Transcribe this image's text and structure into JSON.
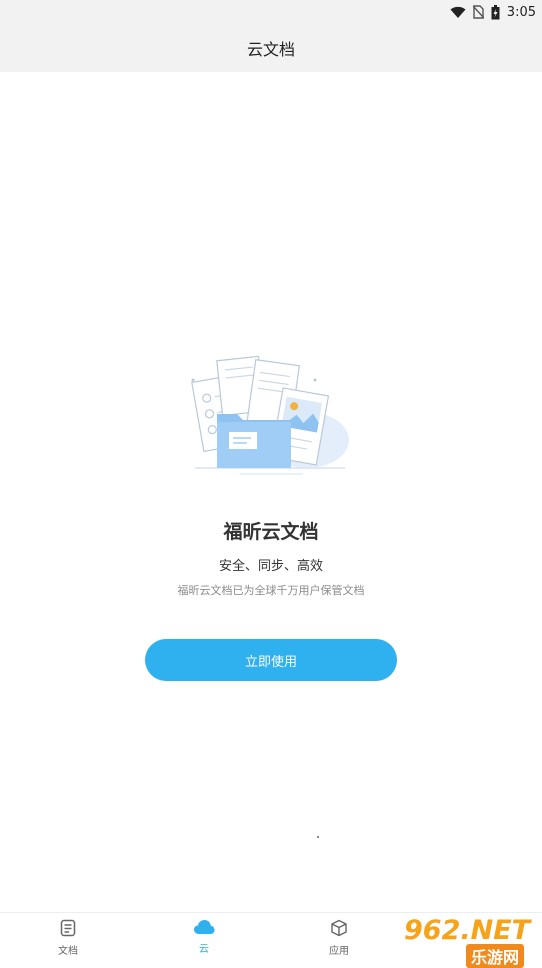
{
  "status_bar": {
    "time": "3:05"
  },
  "header": {
    "title": "云文档"
  },
  "main": {
    "app_name": "福昕云文档",
    "tagline": "安全、同步、高效",
    "description": "福昕云文档已为全球千万用户保管文档",
    "start_button_label": "立即使用"
  },
  "bottom_nav": {
    "items": [
      {
        "label": "文档",
        "icon": "document-icon",
        "active": false
      },
      {
        "label": "云",
        "icon": "cloud-icon",
        "active": true
      },
      {
        "label": "应用",
        "icon": "box-icon",
        "active": false
      }
    ]
  },
  "watermark": {
    "top": "962.NET",
    "bottom": "乐游网"
  },
  "colors": {
    "accent": "#2fb0ef",
    "header_bg": "#f2f2f2",
    "folder": "#8ec3f1"
  }
}
